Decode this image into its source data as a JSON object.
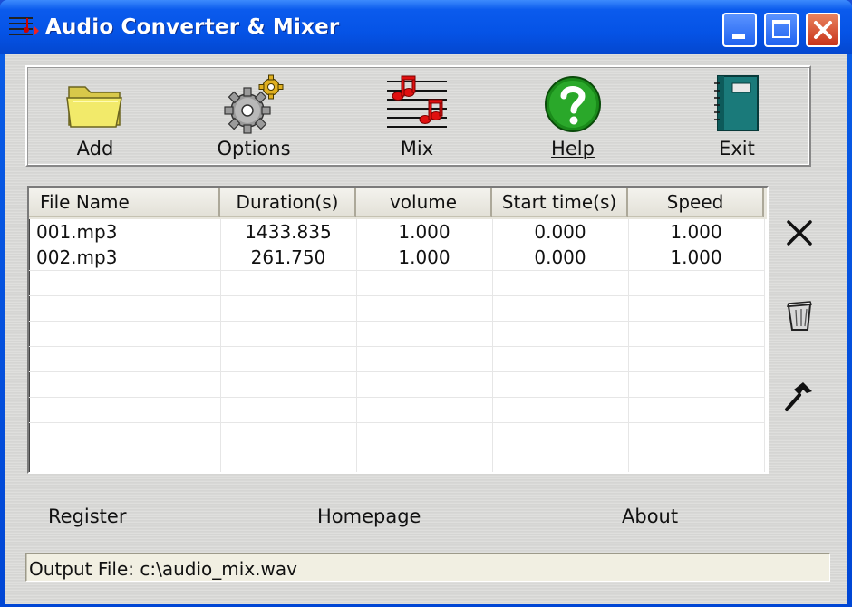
{
  "window": {
    "title": "Audio Converter & Mixer"
  },
  "toolbar": {
    "items": [
      {
        "label": "Add",
        "icon": "folder-icon"
      },
      {
        "label": "Options",
        "icon": "gears-icon"
      },
      {
        "label": "Mix",
        "icon": "music-notes-icon"
      },
      {
        "label": "Help",
        "icon": "help-icon"
      },
      {
        "label": "Exit",
        "icon": "book-icon"
      }
    ]
  },
  "table": {
    "columns": [
      "File Name",
      "Duration(s)",
      "volume",
      "Start time(s)",
      "Speed"
    ],
    "rows": [
      [
        "001.mp3",
        "1433.835",
        "1.000",
        "0.000",
        "1.000"
      ],
      [
        "002.mp3",
        "261.750",
        "1.000",
        "0.000",
        "1.000"
      ]
    ]
  },
  "side_tools": [
    {
      "icon": "delete-x-icon"
    },
    {
      "icon": "trash-icon"
    },
    {
      "icon": "hammer-icon"
    }
  ],
  "links": {
    "register": "Register",
    "homepage": "Homepage",
    "about": "About"
  },
  "output": {
    "text": "Output File: c:\\audio_mix.wav"
  },
  "colors": {
    "titlebar": "#0553e6",
    "client_bg": "#d8d8d6",
    "close_button": "#c9341a"
  }
}
